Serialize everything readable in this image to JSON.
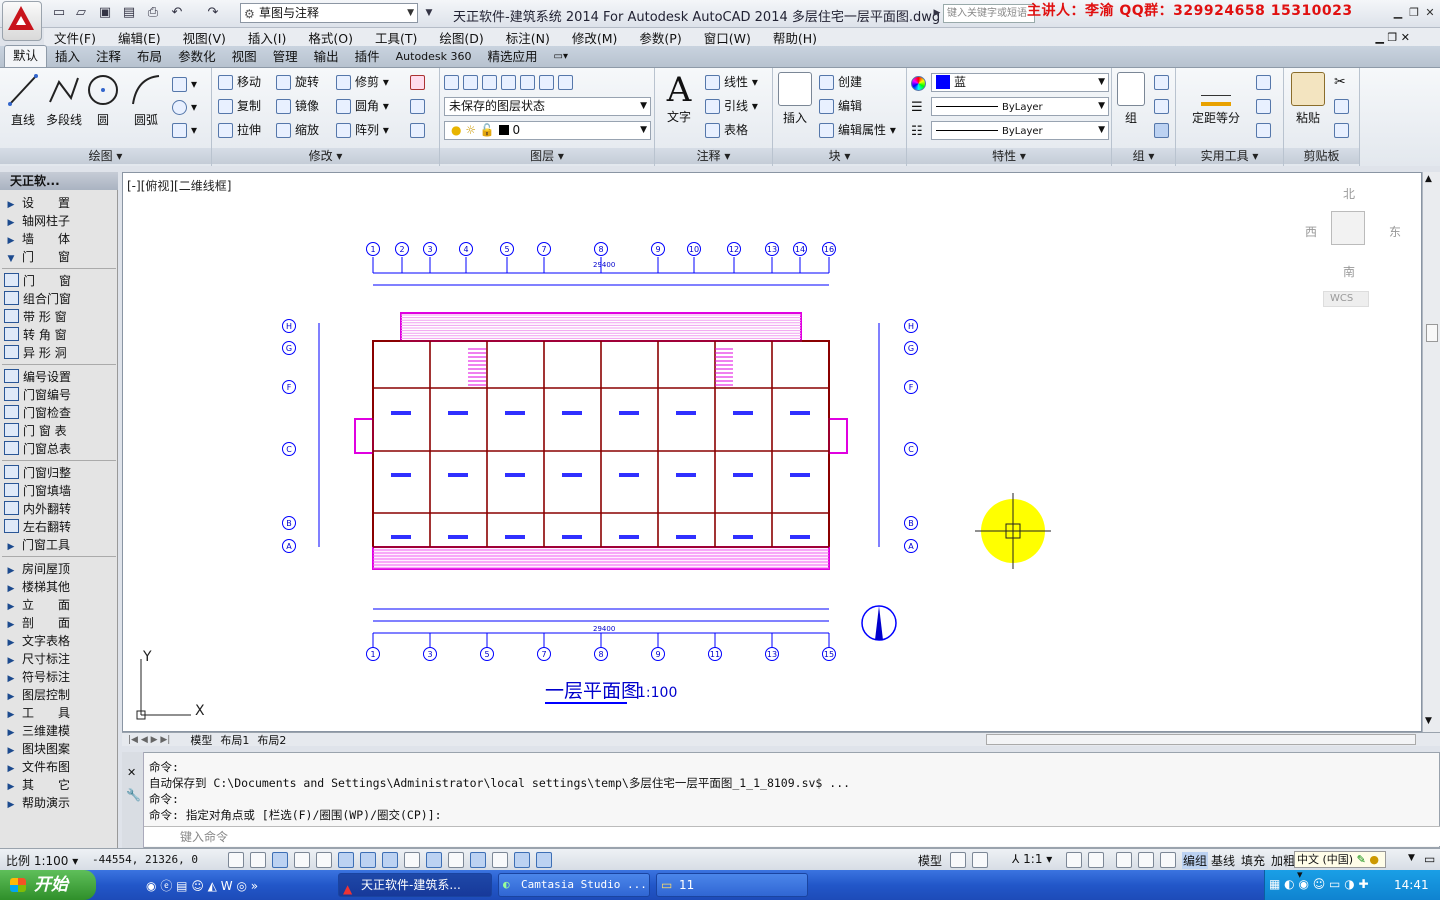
{
  "title_bar": {
    "workspace": "草图与注释",
    "title": "天正软件-建筑系统 2014  For Autodesk AutoCAD 2014    多层住宅一层平面图.dwg",
    "search_placeholder": "键入关键字或短语",
    "overlay": "主讲人：李渝    QQ群：329924658   15310023"
  },
  "menubar": [
    "文件(F)",
    "编辑(E)",
    "视图(V)",
    "插入(I)",
    "格式(O)",
    "工具(T)",
    "绘图(D)",
    "标注(N)",
    "修改(M)",
    "参数(P)",
    "窗口(W)",
    "帮助(H)"
  ],
  "ribbon_tabs": [
    "默认",
    "插入",
    "注释",
    "布局",
    "参数化",
    "视图",
    "管理",
    "输出",
    "插件",
    "Autodesk 360",
    "精选应用"
  ],
  "ribbon": {
    "draw": {
      "title": "绘图",
      "line": "直线",
      "pline": "多段线",
      "circle": "圆",
      "arc": "圆弧"
    },
    "modify": {
      "title": "修改",
      "move": "移动",
      "rotate": "旋转",
      "trim": "修剪",
      "copy": "复制",
      "mirror": "镜像",
      "fillet": "圆角",
      "stretch": "拉伸",
      "scale": "缩放",
      "array": "阵列"
    },
    "layers": {
      "title": "图层",
      "state": "未保存的图层状态",
      "current": "0"
    },
    "annotation": {
      "title": "注释",
      "text": "文字",
      "linear": "线性",
      "leader": "引线",
      "table": "表格"
    },
    "block": {
      "title": "块",
      "insert": "插入",
      "create": "创建",
      "edit": "编辑",
      "attr": "编辑属性"
    },
    "properties": {
      "title": "特性",
      "color": "蓝",
      "linetype": "ByLayer",
      "lineweight": "ByLayer"
    },
    "groups": {
      "title": "组",
      "group": "组"
    },
    "utilities": {
      "title": "实用工具",
      "measure": "定距等分"
    },
    "clipboard": {
      "title": "剪贴板",
      "paste": "粘贴"
    }
  },
  "palette": {
    "title": "天正软...",
    "items": [
      {
        "label": "设　　置",
        "kind": "tri"
      },
      {
        "label": "轴网柱子",
        "kind": "tri"
      },
      {
        "label": "墙　　体",
        "kind": "tri"
      },
      {
        "label": "门　　窗",
        "kind": "open"
      },
      {
        "label": "门　　窗",
        "kind": "icon"
      },
      {
        "label": "组合门窗",
        "kind": "icon"
      },
      {
        "label": "带 形 窗",
        "kind": "icon"
      },
      {
        "label": "转 角 窗",
        "kind": "icon"
      },
      {
        "label": "异 形 洞",
        "kind": "icon"
      },
      {
        "label": "编号设置",
        "kind": "icon"
      },
      {
        "label": "门窗编号",
        "kind": "icon"
      },
      {
        "label": "门窗检查",
        "kind": "icon"
      },
      {
        "label": "门 窗 表",
        "kind": "icon"
      },
      {
        "label": "门窗总表",
        "kind": "icon"
      },
      {
        "label": "门窗归整",
        "kind": "icon"
      },
      {
        "label": "门窗填墙",
        "kind": "icon"
      },
      {
        "label": "内外翻转",
        "kind": "icon"
      },
      {
        "label": "左右翻转",
        "kind": "icon"
      },
      {
        "label": "门窗工具",
        "kind": "tri"
      },
      {
        "label": "房间屋顶",
        "kind": "tri"
      },
      {
        "label": "楼梯其他",
        "kind": "tri"
      },
      {
        "label": "立　　面",
        "kind": "tri"
      },
      {
        "label": "剖　　面",
        "kind": "tri"
      },
      {
        "label": "文字表格",
        "kind": "tri"
      },
      {
        "label": "尺寸标注",
        "kind": "tri"
      },
      {
        "label": "符号标注",
        "kind": "tri"
      },
      {
        "label": "图层控制",
        "kind": "tri"
      },
      {
        "label": "工　　具",
        "kind": "tri"
      },
      {
        "label": "三维建模",
        "kind": "tri"
      },
      {
        "label": "图块图案",
        "kind": "tri"
      },
      {
        "label": "文件布图",
        "kind": "tri"
      },
      {
        "label": "其　　它",
        "kind": "tri"
      },
      {
        "label": "帮助演示",
        "kind": "tri"
      }
    ]
  },
  "drawing": {
    "view_label": "[-][俯视][二维线框]",
    "plan_title": "一层平面图",
    "plan_scale": "1:100",
    "viewcube": {
      "n": "北",
      "s": "南",
      "e": "东",
      "w": "西",
      "wcs": "WCS"
    },
    "top_axes": [
      "1",
      "2",
      "3",
      "4",
      "5",
      "7",
      "8",
      "9",
      "10",
      "12",
      "13",
      "14",
      "16"
    ],
    "bottom_axes": [
      "1",
      "3",
      "5",
      "7",
      "8",
      "9",
      "11",
      "13",
      "15"
    ],
    "side_axes": [
      "H",
      "G",
      "F",
      "C",
      "B",
      "A"
    ],
    "total_dim": "29400",
    "axis_y": "Y",
    "axis_x": "X"
  },
  "layout_tabs": [
    "模型",
    "布局1",
    "布局2"
  ],
  "command": {
    "lines": [
      "命令:",
      "自动保存到 C:\\Documents and Settings\\Administrator\\local settings\\temp\\多层住宅一层平面图_1_1_8109.sv$ ...",
      "命令:",
      "命令: 指定对角点或 [栏选(F)/圈围(WP)/圈交(CP)]:"
    ],
    "placeholder": "键入命令"
  },
  "status": {
    "scale": "比例 1:100",
    "coords": "-44554, 21326, 0",
    "model": "模型",
    "anno_scale": "1:1",
    "right_items": [
      "编组",
      "基线",
      "填充",
      "加粗"
    ],
    "ime": "中文 (中国)"
  },
  "taskbar": {
    "start": "开始",
    "tasks": [
      "天正软件-建筑系...",
      "Camtasia Studio ...",
      "11"
    ],
    "clock": "14:41"
  }
}
